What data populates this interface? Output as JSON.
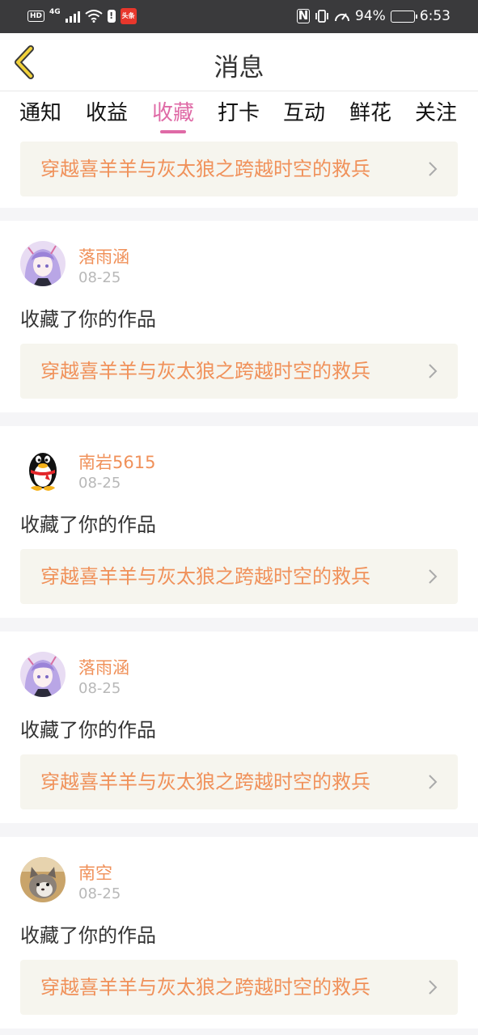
{
  "status_bar": {
    "hd": "HD",
    "network": "4G",
    "app_badge": "头条",
    "battery": "94%",
    "battery_level": 0.94,
    "time": "6:53"
  },
  "header": {
    "title": "消息"
  },
  "tabs": [
    {
      "label": "通知"
    },
    {
      "label": "收益"
    },
    {
      "label": "收藏",
      "active": true
    },
    {
      "label": "打卡"
    },
    {
      "label": "互动"
    },
    {
      "label": "鲜花"
    },
    {
      "label": "关注"
    }
  ],
  "feed": {
    "top_work": "穿越喜羊羊与灰太狼之跨越时空的救兵",
    "items": [
      {
        "user": "落雨涵",
        "date": "08-25",
        "action": "收藏了你的作品",
        "work": "穿越喜羊羊与灰太狼之跨越时空的救兵",
        "avatar": "anime-girl-avatar"
      },
      {
        "user": "南岩5615",
        "date": "08-25",
        "action": "收藏了你的作品",
        "work": "穿越喜羊羊与灰太狼之跨越时空的救兵",
        "avatar": "qq-penguin-avatar"
      },
      {
        "user": "落雨涵",
        "date": "08-25",
        "action": "收藏了你的作品",
        "work": "穿越喜羊羊与灰太狼之跨越时空的救兵",
        "avatar": "anime-girl-avatar"
      },
      {
        "user": "南空",
        "date": "08-25",
        "action": "收藏了你的作品",
        "work": "穿越喜羊羊与灰太狼之跨越时空的救兵",
        "avatar": "cat-photo-avatar"
      }
    ]
  },
  "colors": {
    "accent_pink": "#df6aa6",
    "name_orange": "#f0915a",
    "back_yellow": "#f2d23a"
  }
}
